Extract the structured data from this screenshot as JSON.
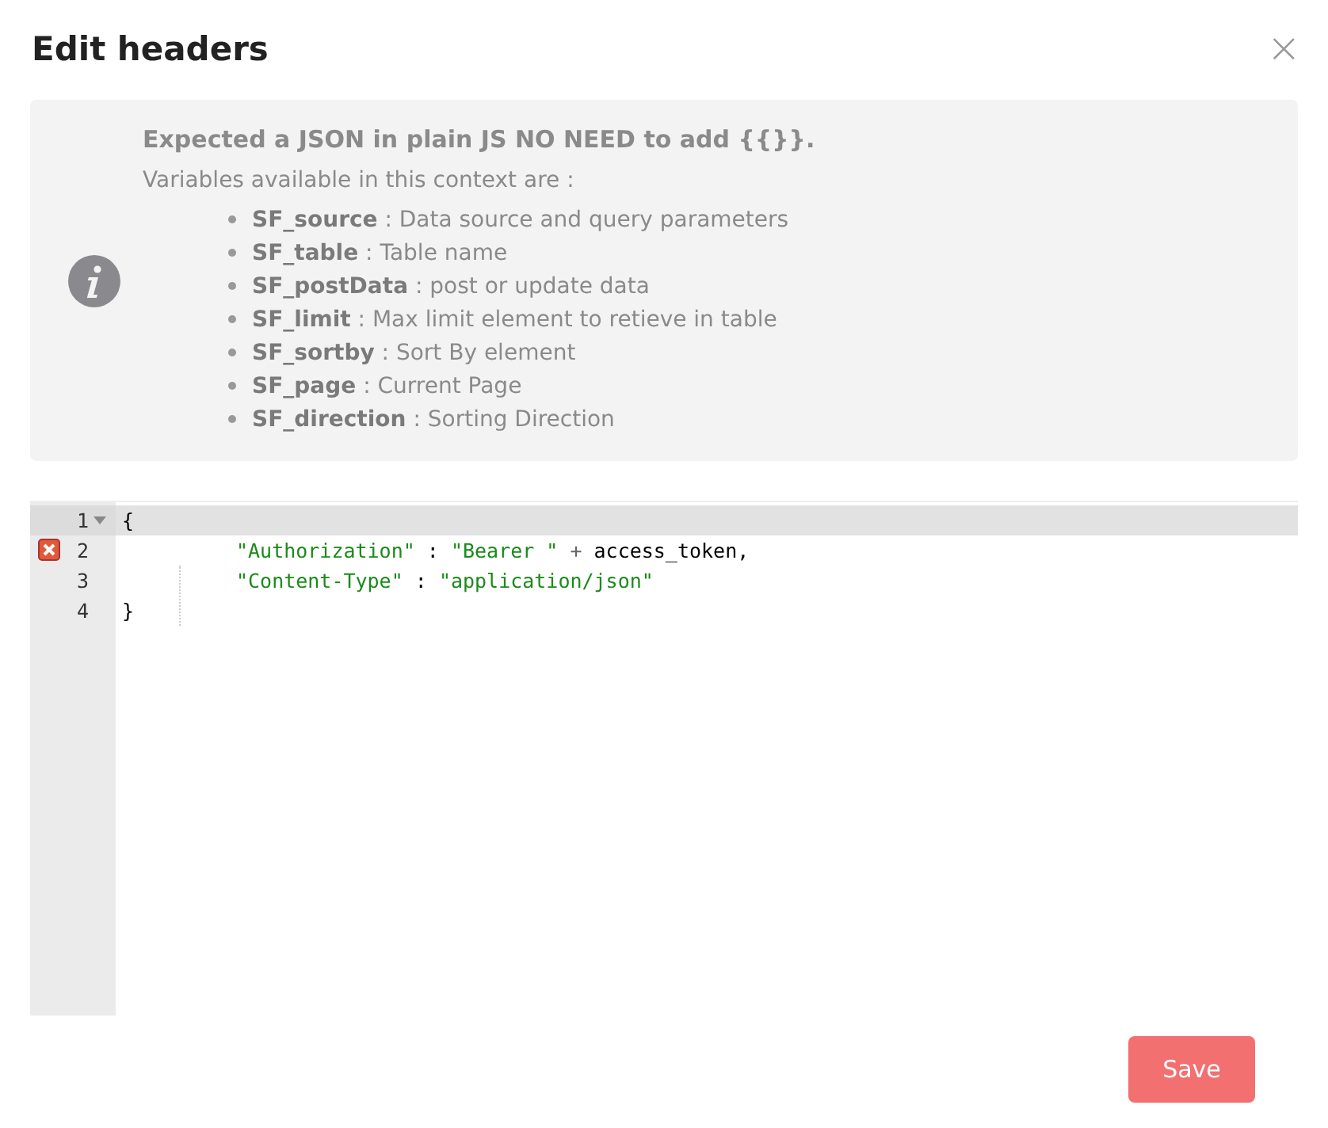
{
  "dialog": {
    "title": "Edit headers",
    "close_label": "×"
  },
  "info": {
    "heading": "Expected a JSON in plain JS NO NEED to add {{}}.",
    "intro": "Variables available in this context are :",
    "variables": [
      {
        "name": "SF_source",
        "description": " : Data source and query parameters"
      },
      {
        "name": "SF_table",
        "description": " : Table name"
      },
      {
        "name": "SF_postData",
        "description": " : post or update data"
      },
      {
        "name": "SF_limit",
        "description": " : Max limit element to retieve in table"
      },
      {
        "name": "SF_sortby",
        "description": " : Sort By element"
      },
      {
        "name": "SF_page",
        "description": " : Current Page"
      },
      {
        "name": "SF_direction",
        "description": " : Sorting Direction"
      }
    ]
  },
  "editor": {
    "lines": [
      {
        "number": "1",
        "active": true,
        "foldable": true,
        "error": false,
        "indented": false,
        "tokens": [
          {
            "kind": "plain",
            "text": "{"
          }
        ]
      },
      {
        "number": "2",
        "active": false,
        "foldable": false,
        "error": true,
        "indented": true,
        "tokens": [
          {
            "kind": "string",
            "text": "\"Authorization\""
          },
          {
            "kind": "plain",
            "text": " : "
          },
          {
            "kind": "string",
            "text": "\"Bearer \""
          },
          {
            "kind": "operator",
            "text": " + "
          },
          {
            "kind": "plain",
            "text": "access_token,"
          }
        ]
      },
      {
        "number": "3",
        "active": false,
        "foldable": false,
        "error": false,
        "indented": true,
        "tokens": [
          {
            "kind": "string",
            "text": "\"Content-Type\""
          },
          {
            "kind": "plain",
            "text": " : "
          },
          {
            "kind": "string",
            "text": "\"application/json\""
          }
        ]
      },
      {
        "number": "4",
        "active": false,
        "foldable": false,
        "error": false,
        "indented": false,
        "tokens": [
          {
            "kind": "plain",
            "text": "}"
          }
        ]
      }
    ]
  },
  "buttons": [
    {
      "label": "Save"
    }
  ]
}
